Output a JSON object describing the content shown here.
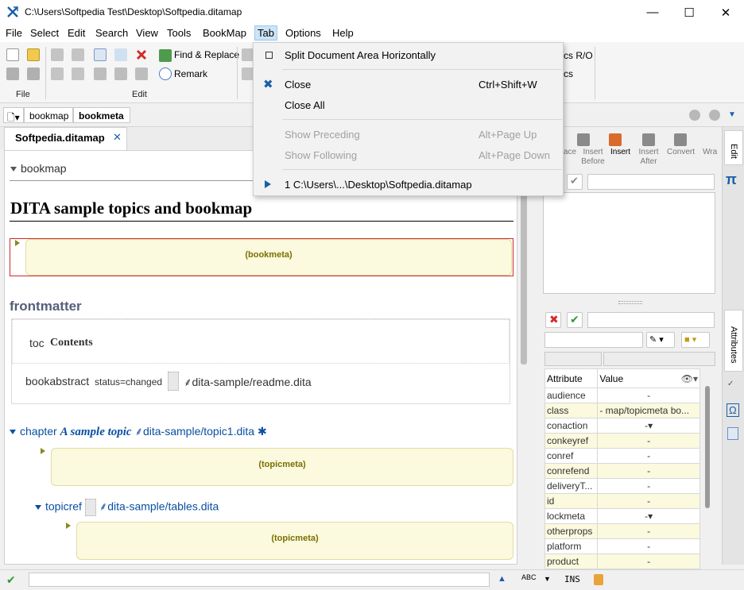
{
  "window": {
    "title": "C:\\Users\\Softpedia Test\\Desktop\\Softpedia.ditamap",
    "minimize": "—",
    "maximize": "☐",
    "close": "✕"
  },
  "menubar": [
    "File",
    "Select",
    "Edit",
    "Search",
    "View",
    "Tools",
    "BookMap",
    "Tab",
    "Options",
    "Help"
  ],
  "ribbon": {
    "find_replace": "Find & Replace",
    "remark": "Remark",
    "file_group": "File",
    "edit_group": "Edit",
    "hidden_label1": "cs R/O",
    "hidden_label2": "cs"
  },
  "breadcrumb": [
    "bookmap",
    "bookmeta"
  ],
  "doc_tab": {
    "label": "Softpedia.ditamap",
    "close": "✕"
  },
  "document": {
    "root": "bookmap",
    "title": "DITA sample topics and bookmap",
    "bookmeta": "(bookmeta)",
    "frontmatter": "frontmatter",
    "toc_label": "toc",
    "toc_value": "Contents",
    "bookabstract": "bookabstract",
    "bookabstract_attr": "status=changed",
    "bookabstract_href": "dita-sample/readme.dita",
    "chapter_label": "chapter",
    "chapter_title": "A sample topic",
    "chapter_href": "dita-sample/topic1.dita",
    "topicmeta": "(topicmeta)",
    "topicref_label": "topicref",
    "topicref_href": "dita-sample/tables.dita",
    "topicmeta2": "(topicmeta)"
  },
  "tab_menu": {
    "split": "Split Document Area Horizontally",
    "close": "Close",
    "close_shortcut": "Ctrl+Shift+W",
    "close_all": "Close All",
    "show_preceding": "Show Preceding",
    "show_preceding_shortcut": "Alt+Page Up",
    "show_following": "Show Following",
    "show_following_shortcut": "Alt+Page Down",
    "recent": "1 C:\\Users\\...\\Desktop\\Softpedia.ditamap"
  },
  "edit_panel": {
    "buttons": [
      "ace",
      "Insert Before",
      "Insert",
      "Insert After",
      "Convert",
      "Wra"
    ]
  },
  "right_tabs": {
    "edit": "Edit",
    "attributes": "Attributes"
  },
  "attributes": {
    "col_attribute": "Attribute",
    "col_value": "Value",
    "rows": [
      {
        "name": "audience",
        "value": "-"
      },
      {
        "name": "class",
        "value": "- map/topicmeta bo..."
      },
      {
        "name": "conaction",
        "value": "-▾"
      },
      {
        "name": "conkeyref",
        "value": "-"
      },
      {
        "name": "conref",
        "value": "-"
      },
      {
        "name": "conrefend",
        "value": "-"
      },
      {
        "name": "deliveryT...",
        "value": "-"
      },
      {
        "name": "id",
        "value": "-"
      },
      {
        "name": "lockmeta",
        "value": "-▾"
      },
      {
        "name": "otherprops",
        "value": "-"
      },
      {
        "name": "platform",
        "value": "-"
      },
      {
        "name": "product",
        "value": "-"
      }
    ]
  },
  "statusbar": {
    "mode": "INS"
  },
  "colors": {
    "accent_blue": "#0a4fa3",
    "meta_bg": "#fbf9de",
    "menu_highlight": "#cce4f7"
  }
}
